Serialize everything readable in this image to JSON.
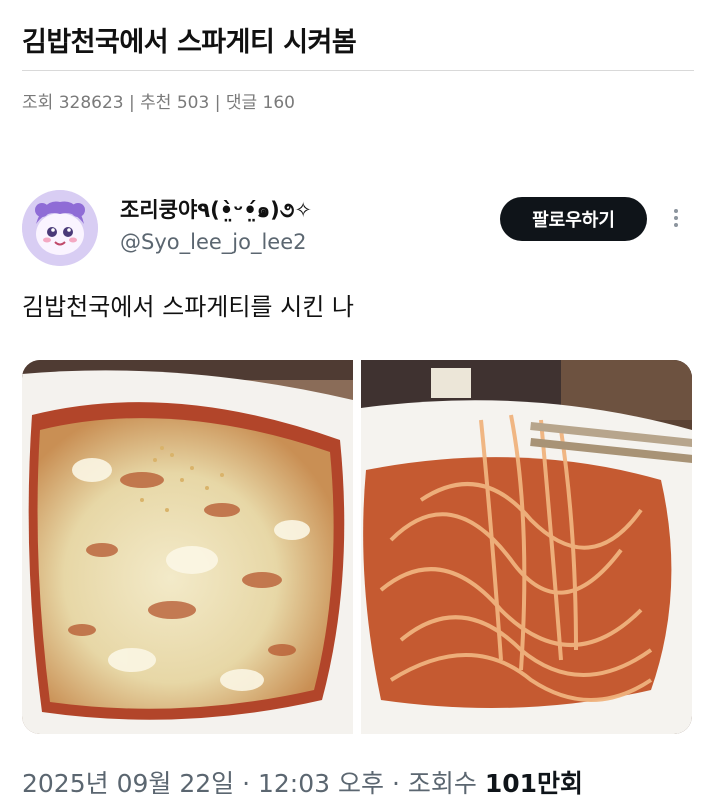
{
  "post": {
    "title": "김밥천국에서 스파게티 시켜봄",
    "meta": {
      "views_label": "조회",
      "views": "328623",
      "recommend_label": "추천",
      "recommend": "503",
      "comments_label": "댓글",
      "comments": "160",
      "separator": "|"
    }
  },
  "tweet": {
    "display_name": "조리쿵야٩(•̤̀ᵕ•̤́๑)૭✧",
    "handle": "@Syo_lee_jo_lee2",
    "follow_label": "팔로우하기",
    "text": "김밥천국에서 스파게티를 시킨 나",
    "images": [
      {
        "name": "cheese-topped-dish-photo"
      },
      {
        "name": "spaghetti-chopsticks-photo"
      }
    ],
    "footer": {
      "date": "2025년 09월 22일",
      "time": "12:03 오후",
      "views_label": "조회수",
      "views_number": "101",
      "views_unit": "만회",
      "dot": "·"
    }
  },
  "colors": {
    "accent_button": "#0f1419",
    "secondary_text": "#5b6670",
    "meta_text": "#7a7a7a"
  }
}
